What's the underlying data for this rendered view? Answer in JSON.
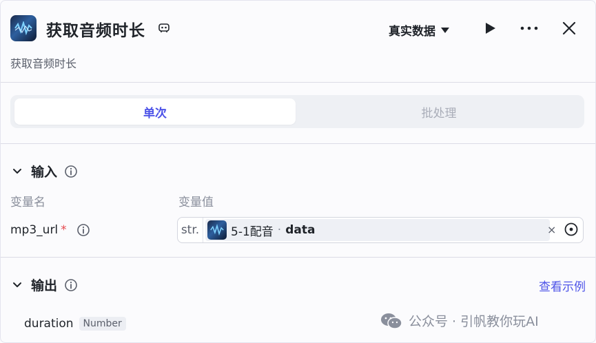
{
  "header": {
    "title": "获取音频时长",
    "subtitle": "获取音频时长",
    "mode_label": "真实数据"
  },
  "tabs": [
    {
      "label": "单次",
      "active": true
    },
    {
      "label": "批处理",
      "active": false
    }
  ],
  "input": {
    "title": "输入",
    "col_name": "变量名",
    "col_value": "变量值",
    "variable": {
      "name": "mp3_url",
      "required_mark": "*",
      "type": "str.",
      "ref_node": "5-1配音",
      "ref_sep": "·",
      "ref_field": "data",
      "clear_label": "×"
    }
  },
  "output": {
    "title": "输出",
    "view_example_label": "查看示例",
    "field": {
      "name": "duration",
      "type": "Number"
    }
  },
  "watermark": {
    "text": "公众号 · 引帆教你玩AI"
  },
  "colors": {
    "accent": "#4d53e8",
    "required": "#e5484d",
    "muted": "#8a8f9c"
  }
}
